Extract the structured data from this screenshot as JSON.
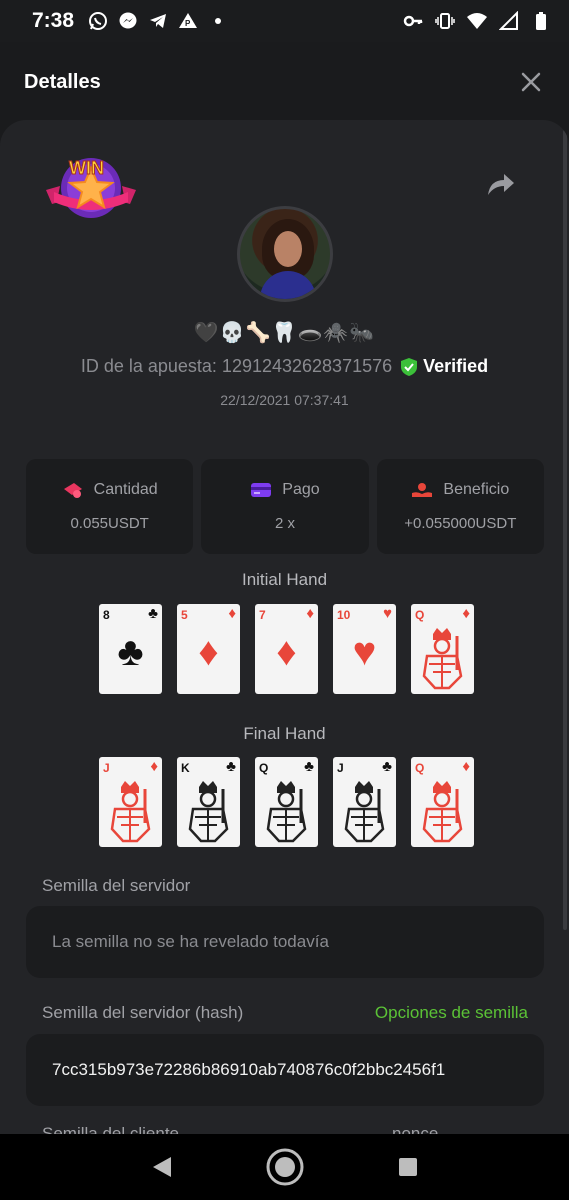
{
  "status_bar": {
    "time": "7:38",
    "left_icons": [
      "whatsapp-icon",
      "messenger-icon",
      "telegram-icon",
      "p-icon",
      "dot-icon"
    ],
    "right_icons": [
      "key-icon",
      "vibrate-icon",
      "wifi-icon",
      "signal-icon",
      "battery-icon"
    ]
  },
  "header": {
    "title": "Detalles"
  },
  "profile": {
    "emoji_name": "🖤💀🦴🦷🕳️🕷️🐜",
    "bet_id_label": "ID de la apuesta: 12912432628371576",
    "verified_label": "Verified",
    "date": "22/12/2021 07:37:41",
    "badge_text": "WIN"
  },
  "stats": [
    {
      "label": "Cantidad",
      "value": "0.055USDT",
      "icon": "coins-icon"
    },
    {
      "label": "Pago",
      "value": "2 x",
      "icon": "card-icon"
    },
    {
      "label": "Beneficio",
      "value": "+0.055000USDT",
      "icon": "hand-coin-icon"
    }
  ],
  "initial_hand": {
    "title": "Initial Hand",
    "cards": [
      {
        "rank": "8",
        "suit": "♣",
        "color": "black",
        "face": false
      },
      {
        "rank": "5",
        "suit": "♦",
        "color": "red",
        "face": false
      },
      {
        "rank": "7",
        "suit": "♦",
        "color": "red",
        "face": false
      },
      {
        "rank": "10",
        "suit": "♥",
        "color": "red",
        "face": false
      },
      {
        "rank": "Q",
        "suit": "♦",
        "color": "red",
        "face": true
      }
    ]
  },
  "final_hand": {
    "title": "Final Hand",
    "cards": [
      {
        "rank": "J",
        "suit": "♦",
        "color": "red",
        "face": true
      },
      {
        "rank": "K",
        "suit": "♣",
        "color": "black",
        "face": true
      },
      {
        "rank": "Q",
        "suit": "♣",
        "color": "black",
        "face": true
      },
      {
        "rank": "J",
        "suit": "♣",
        "color": "black",
        "face": true
      },
      {
        "rank": "Q",
        "suit": "♦",
        "color": "red",
        "face": true
      }
    ]
  },
  "server_seed": {
    "label": "Semilla del servidor",
    "value": "La semilla no se ha revelado todavía"
  },
  "server_seed_hash": {
    "label": "Semilla del servidor (hash)",
    "link": "Opciones de semilla",
    "value": "7cc315b973e72286b86910ab740876c0f2bbc2456f1"
  },
  "client_seed": {
    "label": "Semilla del cliente",
    "nonce_label": "nonce"
  },
  "colors": {
    "accent_green": "#5bc236",
    "panel": "#232427",
    "box": "#1b1c1e",
    "red_suit": "#e8463a"
  }
}
